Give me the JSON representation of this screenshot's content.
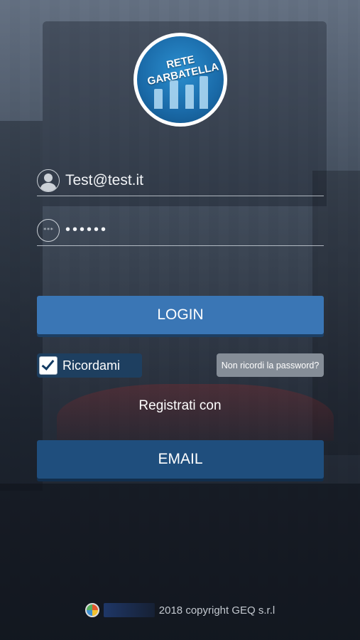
{
  "logo": {
    "line1": "RETE",
    "line2": "GARBATELLA",
    "icon": "rete-garbatella-logo"
  },
  "login_form": {
    "email": {
      "value": "Test@test.it",
      "icon": "user-icon"
    },
    "password": {
      "value": "••••••",
      "icon": "password-icon",
      "icon_glyph": "***"
    }
  },
  "buttons": {
    "login_label": "LOGIN",
    "email_label": "EMAIL"
  },
  "remember": {
    "label": "Ricordami",
    "checked": true
  },
  "forgot_password_label": "Non ricordi la password?",
  "register_label": "Registrati con",
  "footer": {
    "copyright": "2018 copyright GEQ s.r.l"
  },
  "colors": {
    "login_button": "#3a76b5",
    "email_button": "#1f4e7d",
    "forgot_button": "#858d97"
  }
}
